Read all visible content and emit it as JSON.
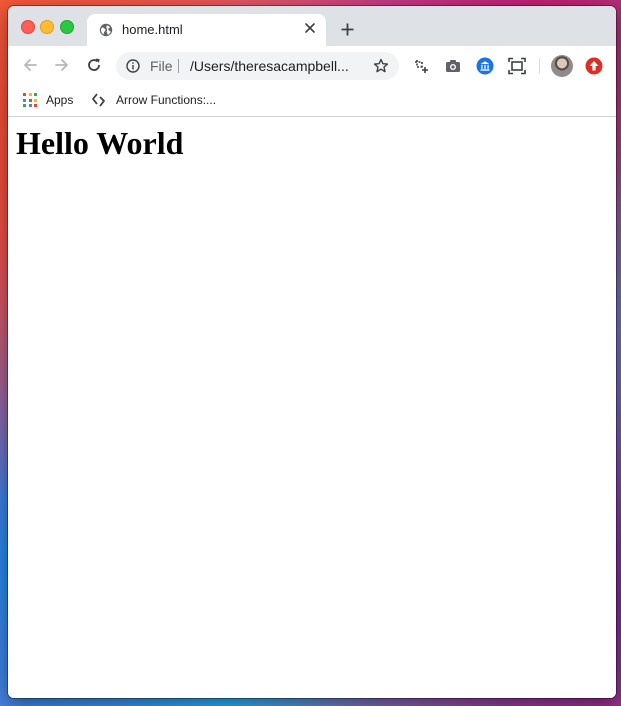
{
  "window": {
    "traffic_lights": {
      "close_color": "#fe5f57",
      "minimize_color": "#febc2e",
      "maximize_color": "#28c840"
    }
  },
  "tab": {
    "title": "home.html",
    "icon": "globe-icon",
    "close_icon": "close-icon"
  },
  "toolbar": {
    "back_icon": "back-arrow-icon",
    "forward_icon": "forward-arrow-icon",
    "reload_icon": "reload-icon",
    "omnibox": {
      "info_icon": "info-icon",
      "scheme": "File",
      "url": "/Users/theresacampbell...",
      "bookmark_icon": "star-icon"
    },
    "extensions": [
      "crop-add-icon",
      "camera-icon",
      "bank-icon",
      "screen-capture-icon"
    ],
    "profile": "avatar",
    "update_icon": "update-arrow-icon",
    "update_color": "#d93025"
  },
  "bookmarks": {
    "items": [
      {
        "label": "Apps",
        "icon": "apps-grid-icon"
      },
      {
        "label": "Arrow Functions:...",
        "icon": "arrow-functions-icon"
      }
    ]
  },
  "page": {
    "heading": "Hello World"
  }
}
